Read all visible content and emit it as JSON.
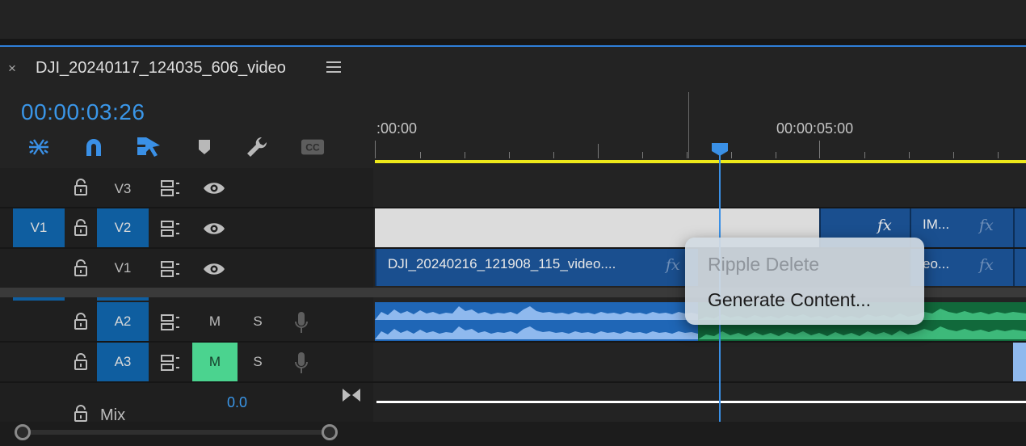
{
  "panel": {
    "close_symbol": "×",
    "sequence_name": "DJI_20240117_124035_606_video",
    "menu_icon": "hamburger-menu-icon"
  },
  "timecode": "00:00:03:26",
  "toolbar": {
    "icons": [
      "nest-sequences-icon",
      "snap-magnet-icon",
      "linked-selection-icon",
      "add-marker-icon",
      "timeline-settings-wrench-icon",
      "captions-cc-icon"
    ]
  },
  "ruler": {
    "labels": [
      ":00:00",
      "00:00:05:00"
    ]
  },
  "tracks": {
    "video": [
      {
        "source": "",
        "name": "V3"
      },
      {
        "source": "V1",
        "name": "V2"
      },
      {
        "source": "",
        "name": "V1"
      }
    ],
    "audio": [
      {
        "name": "A2",
        "mute": "M",
        "solo": "S",
        "muted": false
      },
      {
        "name": "A3",
        "mute": "M",
        "solo": "S",
        "muted": true
      }
    ],
    "mix": {
      "label": "Mix",
      "value": "0.0"
    }
  },
  "clips": {
    "v1_main_name": "DJI_20240216_121908_115_video....",
    "v2_right_name": "IM...",
    "v1_right_name": "eo...",
    "fx_label": "fx"
  },
  "context_menu": {
    "items": [
      {
        "label": "Ripple Delete",
        "enabled": false
      },
      {
        "label": "Generate Content...",
        "enabled": true
      }
    ]
  },
  "colors": {
    "accent_blue": "#3a96e8",
    "work_area_yellow": "#ede81a",
    "mute_active_green": "#4bd38f",
    "clip_blue": "#1a4f8f",
    "audio_green": "#11693b"
  }
}
